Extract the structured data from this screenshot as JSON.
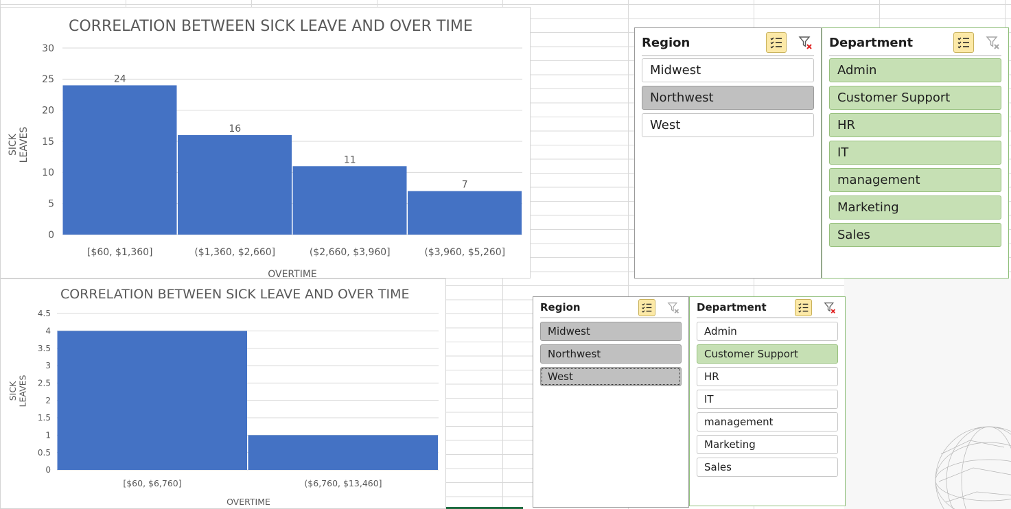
{
  "colors": {
    "bar": "#4472c4",
    "gridline": "#d9d9d9",
    "axis_text": "#595959",
    "selected_gray": "#c0c0c0",
    "selected_green": "#c6e0b4",
    "multiselect_button": "#fce9a7"
  },
  "chart_data": [
    {
      "type": "bar",
      "title": "CORRELATION BETWEEN SICK LEAVE AND OVER TIME",
      "xlabel": "OVERTIME",
      "ylabel": "SICK LEAVES",
      "categories": [
        "[$60, $1,360]",
        "($1,360, $2,660]",
        "($2,660, $3,960]",
        "($3,960, $5,260]"
      ],
      "values": [
        24,
        16,
        11,
        7
      ],
      "data_labels": [
        "24",
        "16",
        "11",
        "7"
      ],
      "yticks": [
        "0",
        "5",
        "10",
        "15",
        "20",
        "25",
        "30"
      ],
      "ylim": [
        0,
        30
      ],
      "grid": true,
      "legend": "none"
    },
    {
      "type": "bar",
      "title": "CORRELATION BETWEEN SICK LEAVE AND OVER TIME",
      "xlabel": "OVERTIME",
      "ylabel": "SICK LEAVES",
      "categories": [
        "[$60, $6,760]",
        "($6,760, $13,460]"
      ],
      "values": [
        4,
        1
      ],
      "data_labels": [],
      "yticks": [
        "0",
        "0.5",
        "1",
        "1.5",
        "2",
        "2.5",
        "3",
        "3.5",
        "4",
        "4.5"
      ],
      "ylim": [
        0,
        4.5
      ],
      "grid": true,
      "legend": "none"
    }
  ],
  "slicers_top": {
    "region": {
      "title": "Region",
      "multiselect_icon": "multi-select-icon",
      "clear_icon": "clear-filter-icon",
      "items": [
        {
          "label": "Midwest",
          "state": "unselected"
        },
        {
          "label": "Northwest",
          "state": "selected"
        },
        {
          "label": "West",
          "state": "unselected"
        }
      ]
    },
    "department": {
      "title": "Department",
      "multiselect_icon": "multi-select-icon",
      "clear_icon": "clear-filter-icon-disabled",
      "items": [
        {
          "label": "Admin",
          "state": "selected"
        },
        {
          "label": "Customer Support",
          "state": "selected"
        },
        {
          "label": "HR",
          "state": "selected"
        },
        {
          "label": "IT",
          "state": "selected"
        },
        {
          "label": "management",
          "state": "selected"
        },
        {
          "label": "Marketing",
          "state": "selected"
        },
        {
          "label": "Sales",
          "state": "selected"
        }
      ]
    }
  },
  "slicers_bottom": {
    "region": {
      "title": "Region",
      "multiselect_icon": "multi-select-icon",
      "clear_icon": "clear-filter-icon-disabled",
      "items": [
        {
          "label": "Midwest",
          "state": "selected"
        },
        {
          "label": "Northwest",
          "state": "selected"
        },
        {
          "label": "West",
          "state": "selected"
        }
      ]
    },
    "department": {
      "title": "Department",
      "multiselect_icon": "multi-select-icon",
      "clear_icon": "clear-filter-icon",
      "items": [
        {
          "label": "Admin",
          "state": "unselected"
        },
        {
          "label": "Customer Support",
          "state": "selected"
        },
        {
          "label": "HR",
          "state": "unselected"
        },
        {
          "label": "IT",
          "state": "unselected"
        },
        {
          "label": "management",
          "state": "unselected"
        },
        {
          "label": "Marketing",
          "state": "unselected"
        },
        {
          "label": "Sales",
          "state": "unselected"
        }
      ]
    }
  }
}
